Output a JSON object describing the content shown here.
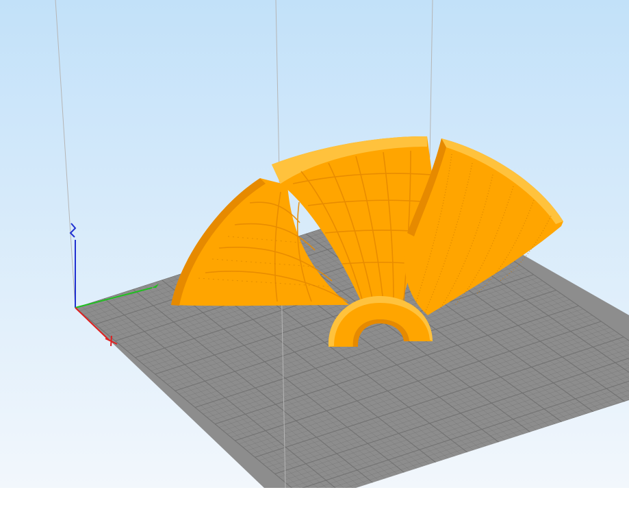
{
  "viewport": {
    "sky_top_color": "#c2e1f9",
    "sky_bottom_color": "#f2f7fc",
    "bed_color": "#8d8d8d",
    "bed_grid_color": "#6f6f6f",
    "model_color": "#ffa500",
    "model_shadow_color": "#e68a00",
    "model_highlight_color": "#ffc23d",
    "guide_line_color": "#b5b5b5",
    "build_volume_lines": 3,
    "objects": [
      {
        "name": "blade-left",
        "type": "fan-blade"
      },
      {
        "name": "blade-center",
        "type": "fan-blade"
      },
      {
        "name": "blade-right",
        "type": "fan-blade"
      },
      {
        "name": "hub-ring",
        "type": "half-ring"
      }
    ]
  },
  "axes": {
    "x": {
      "color": "#e02020",
      "icon": "x-axis-icon"
    },
    "y": {
      "color": "#20c020",
      "icon": "y-axis-icon"
    },
    "z": {
      "color": "#2030d0",
      "icon": "z-axis-icon"
    }
  }
}
